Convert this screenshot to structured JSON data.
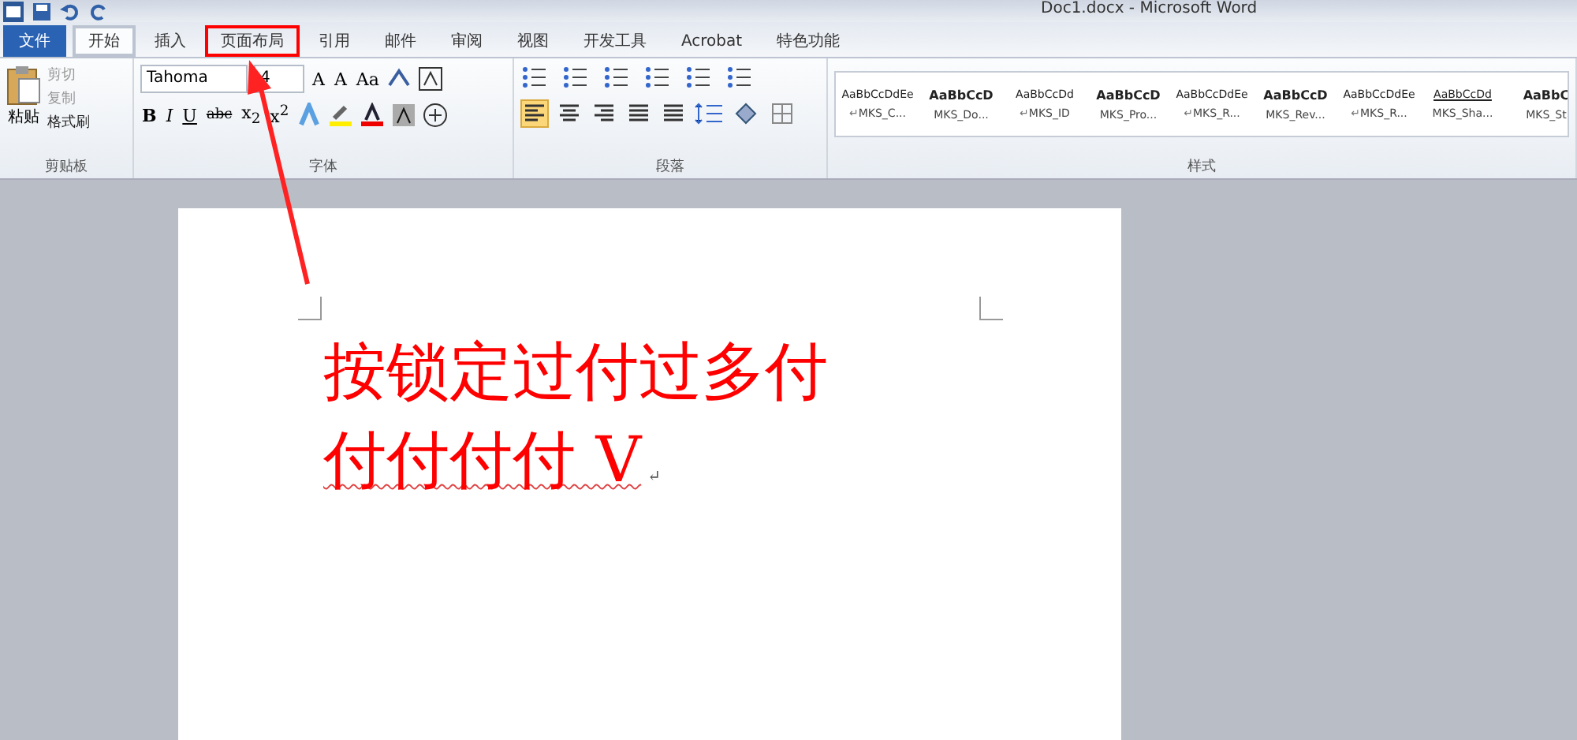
{
  "window": {
    "title": "Doc1.docx - Microsoft Word"
  },
  "tabs": [
    {
      "label": "文件",
      "kind": "file"
    },
    {
      "label": "开始",
      "kind": "tab",
      "selected": true,
      "highlighted": false
    },
    {
      "label": "插入",
      "kind": "tab",
      "selected": false,
      "highlighted": false
    },
    {
      "label": "页面布局",
      "kind": "tab",
      "selected": false,
      "highlighted": true
    },
    {
      "label": "引用",
      "kind": "tab",
      "selected": false,
      "highlighted": false
    },
    {
      "label": "邮件",
      "kind": "tab",
      "selected": false,
      "highlighted": false
    },
    {
      "label": "审阅",
      "kind": "tab",
      "selected": false,
      "highlighted": false
    },
    {
      "label": "视图",
      "kind": "tab",
      "selected": false,
      "highlighted": false
    },
    {
      "label": "开发工具",
      "kind": "tab",
      "selected": false,
      "highlighted": false
    },
    {
      "label": "Acrobat",
      "kind": "tab",
      "selected": false,
      "highlighted": false
    },
    {
      "label": "特色功能",
      "kind": "tab",
      "selected": false,
      "highlighted": false
    }
  ],
  "clipboard": {
    "paste": "粘贴",
    "items": [
      {
        "label": "剪切",
        "disabled": true
      },
      {
        "label": "复制",
        "disabled": true
      },
      {
        "label": "格式刷",
        "disabled": false
      }
    ],
    "label": "剪贴板"
  },
  "font": {
    "name": "Tahoma",
    "size": "4",
    "row1": [
      "A",
      "A",
      "Aa"
    ],
    "row2": [
      "B",
      "I",
      "U",
      "abc",
      "x$_{2}$",
      "x$^{2}$"
    ],
    "label": "字体"
  },
  "paragraph": {
    "align": [
      {
        "selected": true
      },
      {
        "selected": false
      },
      {
        "selected": false
      },
      {
        "selected": false
      },
      {
        "selected": false
      }
    ],
    "label": "段落"
  },
  "styles": {
    "items": [
      {
        "preview": "AaBbCcDdEe",
        "name": "MKS_C...",
        "bold": false,
        "mark": "↵"
      },
      {
        "preview": "AaBbCcD",
        "name": "MKS_Do...",
        "bold": true
      },
      {
        "preview": "AaBbCcDd",
        "name": "MKS_ID",
        "bold": false,
        "mark": "↵"
      },
      {
        "preview": "AaBbCcD",
        "name": "MKS_Pro...",
        "bold": true
      },
      {
        "preview": "AaBbCcDdEe",
        "name": "MKS_R...",
        "bold": false,
        "mark": "↵"
      },
      {
        "preview": "AaBbCcD",
        "name": "MKS_Rev...",
        "bold": true
      },
      {
        "preview": "AaBbCcDdEe",
        "name": "MKS_R...",
        "bold": false,
        "mark": "↵"
      },
      {
        "preview": "AaBbCcDd",
        "name": "MKS_Sha...",
        "bold": false
      },
      {
        "preview": "AaBbC",
        "name": "MKS_St",
        "bold": true
      }
    ],
    "label": "样式"
  },
  "document": {
    "lines": [
      {
        "text": "按锁定过付过多付",
        "misspelled": false
      },
      {
        "text": "付付付付 V",
        "misspelled": true
      }
    ],
    "paragraph_mark": "↵"
  }
}
